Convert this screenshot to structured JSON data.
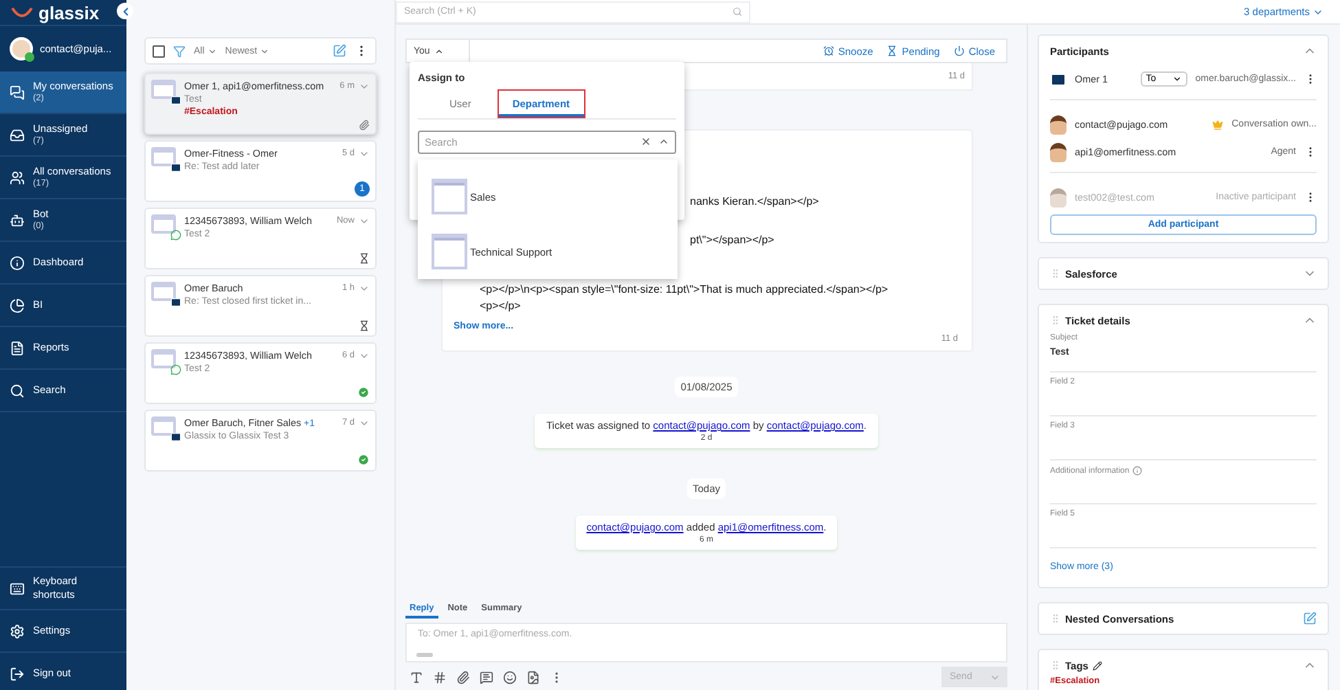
{
  "sidebar": {
    "logo": "glassix",
    "user": "contact@puja...",
    "nav": [
      {
        "label": "My conversations",
        "count": "(2)",
        "selected": true
      },
      {
        "label": "Unassigned",
        "count": "(7)",
        "selected": false
      },
      {
        "label": "All conversations",
        "count": "(17)",
        "selected": false
      },
      {
        "label": "Bot",
        "count": "(0)",
        "selected": false
      },
      {
        "label": "Dashboard",
        "selected": false
      },
      {
        "label": "BI",
        "selected": false
      },
      {
        "label": "Reports",
        "selected": false
      },
      {
        "label": "Search",
        "selected": false
      }
    ],
    "bottom": [
      {
        "label": "Keyboard shortcuts"
      },
      {
        "label": "Settings"
      },
      {
        "label": "Sign out"
      }
    ]
  },
  "list_toolbar": {
    "checked": false,
    "filter": "All",
    "sort": "Newest"
  },
  "conversations": [
    {
      "name": "Omer 1, api1@omerfitness.com",
      "subject": "Test",
      "kind": "email",
      "time": "6 m",
      "tag": "#Escalation",
      "attachment": true,
      "pending": false,
      "resolved": false,
      "selected": true
    },
    {
      "name": "Omer-Fitness - Omer",
      "subject": "Re: Test add later",
      "kind": "email",
      "time": "5 d",
      "unread_count": "1",
      "attachment": false,
      "pending": false,
      "resolved": false,
      "selected": false
    },
    {
      "name": "12345673893, William Welch",
      "subject": "Test 2",
      "kind": "whatsapp",
      "time": "Now",
      "attachment": false,
      "pending": true,
      "resolved": false,
      "selected": false
    },
    {
      "name": "Omer Baruch",
      "subject": "Re: Test closed first ticket in...",
      "kind": "email",
      "time": "1 h",
      "attachment": false,
      "pending": true,
      "resolved": false,
      "selected": false
    },
    {
      "name": "12345673893, William Welch",
      "subject": "Test 2",
      "kind": "whatsapp",
      "time": "6 d",
      "attachment": false,
      "pending": false,
      "resolved": true,
      "selected": false
    },
    {
      "name": "Omer Baruch, Fitner Sales",
      "extra": "+1",
      "subject": "Glassix to Glassix Test 3",
      "kind": "email",
      "time": "7 d",
      "attachment": false,
      "pending": false,
      "resolved": true,
      "selected": false
    }
  ],
  "top_bar": {
    "search_placeholder": "Search (Ctrl + K)",
    "departments": "3 departments"
  },
  "conversation_header": {
    "assignee": "You",
    "actions": [
      "Snooze",
      "Pending",
      "Close"
    ]
  },
  "messages": [
    {
      "time": "11 d"
    },
    {
      "lines": [
        "nanks Kieran.</span></p>",
        "pt\\\"></span></p>",
        "<p></p>\\n<p><span style=\\\"font-size: 11pt\\\">That is much appreciated.</span></p>",
        "<p></p>"
      ],
      "show_more": "Show more...",
      "time": "11 d"
    }
  ],
  "events": [
    {
      "kind": "date",
      "text": "01/08/2025"
    },
    {
      "kind": "system",
      "segments": [
        {
          "kind": "text",
          "text": "Ticket was assigned to "
        },
        {
          "kind": "link",
          "text": "contact@pujago.com"
        },
        {
          "kind": "text",
          "text": " by "
        },
        {
          "kind": "link",
          "text": "contact@pujago.com"
        },
        {
          "kind": "text",
          "text": "."
        }
      ],
      "time": "2 d"
    },
    {
      "kind": "date",
      "text": "Today"
    },
    {
      "kind": "system",
      "segments": [
        {
          "kind": "link",
          "text": "contact@pujago.com"
        },
        {
          "kind": "text",
          "text": " added "
        },
        {
          "kind": "link",
          "text": "api1@omerfitness.com"
        },
        {
          "kind": "text",
          "text": "."
        }
      ],
      "time": "6 m"
    }
  ],
  "assign_popup": {
    "title": "Assign to",
    "tabs": [
      {
        "label": "User",
        "selected": false
      },
      {
        "label": "Department",
        "selected": true
      }
    ],
    "search_placeholder": "Search",
    "options": [
      "Sales",
      "Technical Support"
    ]
  },
  "composer": {
    "tabs": [
      {
        "label": "Reply",
        "selected": true
      },
      {
        "label": "Note",
        "selected": false
      },
      {
        "label": "Summary",
        "selected": false
      }
    ],
    "placeholder": "To: Omer 1, api1@omerfitness.com.",
    "send": "Send"
  },
  "participants": {
    "title": "Participants",
    "expanded": true,
    "recipient": {
      "name": "Omer 1",
      "mode": "To",
      "address": "omer.baruch@glassix..."
    },
    "members": [
      {
        "email": "contact@pujago.com",
        "role": "Conversation own...",
        "kind": "owner",
        "inactive": false
      },
      {
        "email": "api1@omerfitness.com",
        "role": "Agent",
        "kind": "agent",
        "inactive": false
      },
      {
        "email": "test002@test.com",
        "role": "Inactive participant",
        "kind": "agent",
        "inactive": true
      }
    ],
    "add_button": "Add participant"
  },
  "salesforce": {
    "title": "Salesforce",
    "expanded": false
  },
  "ticket_details": {
    "title": "Ticket details",
    "expanded": true,
    "fields": [
      {
        "label": "Subject",
        "value": "Test"
      },
      {
        "label": "Field 2"
      },
      {
        "label": "Field 3"
      },
      {
        "label": "Additional information",
        "info": true
      },
      {
        "label": "Field 5"
      }
    ],
    "show_more": "Show more (3)"
  },
  "nested": {
    "title": "Nested Conversations"
  },
  "tags": {
    "title": "Tags",
    "expanded": true,
    "items": [
      "#Escalation"
    ]
  }
}
